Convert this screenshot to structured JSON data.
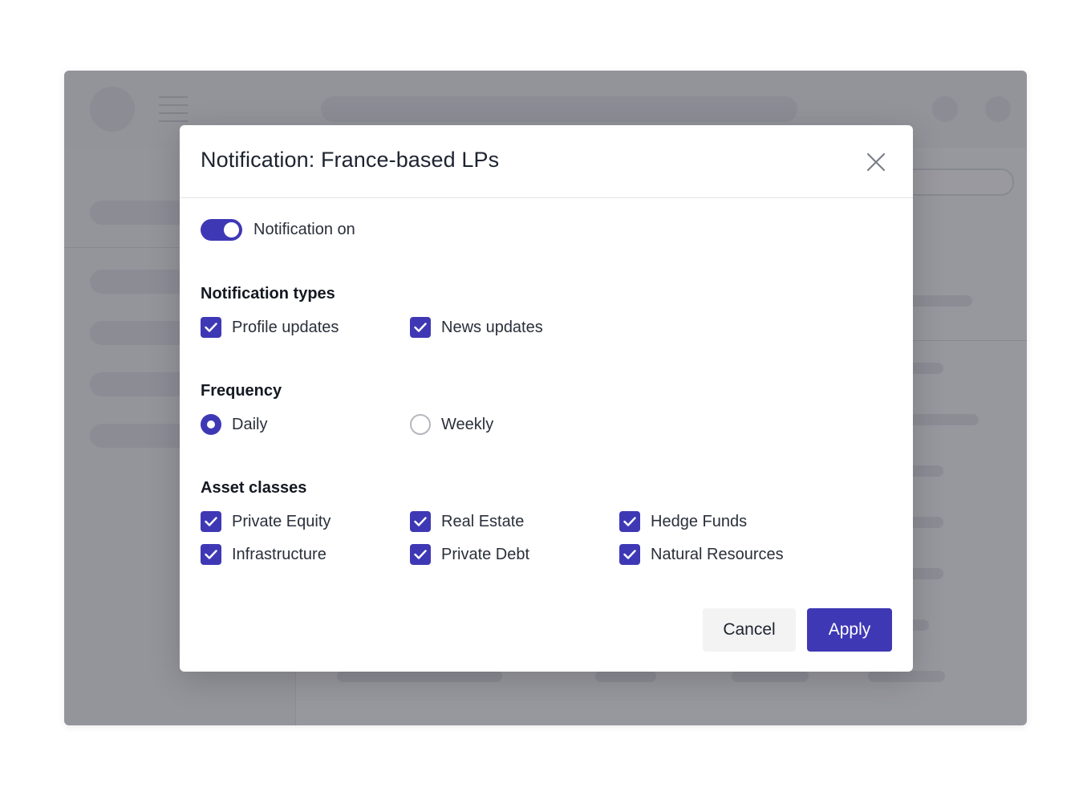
{
  "modal": {
    "title": "Notification: France-based LPs",
    "toggle_label": "Notification on",
    "toggle_on": true
  },
  "sections": {
    "types": {
      "title": "Notification types",
      "options": [
        {
          "label": "Profile updates",
          "checked": true
        },
        {
          "label": "News updates",
          "checked": true
        }
      ]
    },
    "frequency": {
      "title": "Frequency",
      "options": [
        {
          "label": "Daily",
          "selected": true
        },
        {
          "label": "Weekly",
          "selected": false
        }
      ]
    },
    "assets": {
      "title": "Asset classes",
      "options": [
        {
          "label": "Private Equity",
          "checked": true
        },
        {
          "label": "Real Estate",
          "checked": true
        },
        {
          "label": "Hedge Funds",
          "checked": true
        },
        {
          "label": "Infrastructure",
          "checked": true
        },
        {
          "label": "Private Debt",
          "checked": true
        },
        {
          "label": "Natural Resources",
          "checked": true
        }
      ]
    }
  },
  "buttons": {
    "cancel": "Cancel",
    "apply": "Apply"
  },
  "colors": {
    "accent": "#3f38b5",
    "overlay": "#6b6b75"
  },
  "icons": {
    "close": "close-icon",
    "check": "check-icon"
  }
}
